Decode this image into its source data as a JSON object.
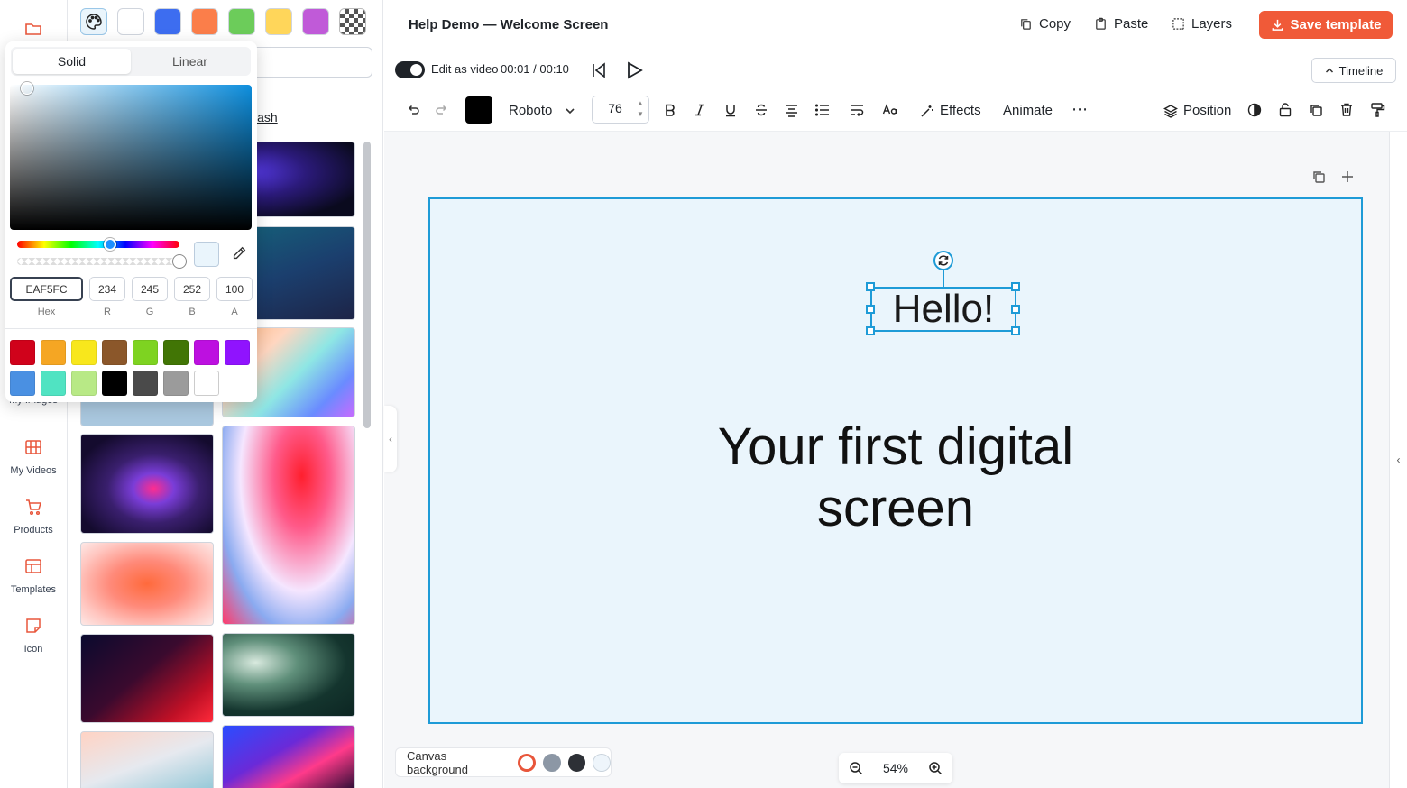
{
  "header": {
    "title": "Help Demo — Welcome Screen",
    "copy_label": "Copy",
    "paste_label": "Paste",
    "layers_label": "Layers",
    "save_label": "Save template"
  },
  "video_bar": {
    "edit_as_video_label": "Edit as video",
    "time_display": "00:01 / 00:10",
    "timeline_label": "Timeline"
  },
  "text_toolbar": {
    "text_color": "#000000",
    "font_family": "Roboto",
    "font_size": "76",
    "effects_label": "Effects",
    "animate_label": "Animate",
    "position_label": "Position"
  },
  "nav": {
    "items": [
      {
        "label": "My Images",
        "icon": "image-icon"
      },
      {
        "label": "My Videos",
        "icon": "film-icon"
      },
      {
        "label": "Products",
        "icon": "cart-icon"
      },
      {
        "label": "Templates",
        "icon": "layout-icon"
      },
      {
        "label": "Icon",
        "icon": "sticker-icon"
      }
    ]
  },
  "panel": {
    "quick_swatches": [
      "#ffffff",
      "#3d6df0",
      "#fb7e4a",
      "#6ccc5a",
      "#ffd65a",
      "#c05ad8"
    ],
    "unsplash_link_partial": "lash"
  },
  "color_picker": {
    "modes": [
      "Solid",
      "Linear"
    ],
    "active_mode": "Solid",
    "hex_value": "EAF5FC",
    "r": "234",
    "g": "245",
    "b": "252",
    "a": "100",
    "labels": {
      "hex": "Hex",
      "r": "R",
      "g": "G",
      "b": "B",
      "a": "A"
    },
    "hue_level": 0.57,
    "alpha_level": 1.0,
    "presets": [
      "#d0021b",
      "#f5a623",
      "#f8e71c",
      "#8b572a",
      "#7ed321",
      "#417505",
      "#bd10e0",
      "#9013fe",
      "#4a90e2",
      "#50e3c2",
      "#b8e986",
      "#000000",
      "#4a4a4a",
      "#9b9b9b",
      "#ffffff"
    ]
  },
  "canvas": {
    "background_color": "#EAF5FC",
    "heading_text": "Hello!",
    "body_text": "Your first digital screen"
  },
  "bottom": {
    "canvas_background_label": "Canvas background",
    "background_options": [
      "#ffffff",
      "#8c97a5",
      "#2d3036",
      "#eef5fb"
    ],
    "zoom_level": "54%"
  }
}
